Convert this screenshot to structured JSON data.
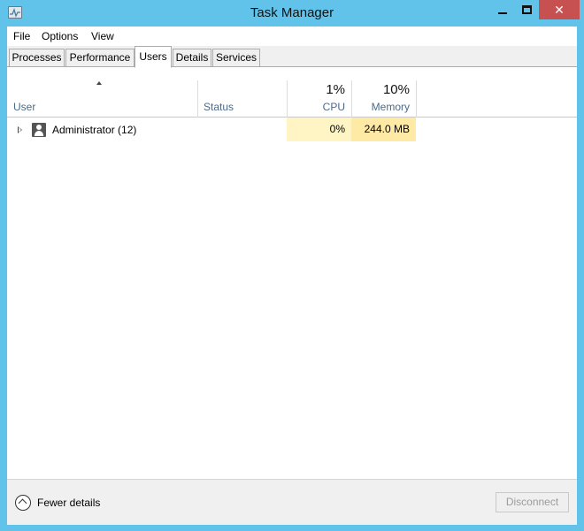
{
  "window": {
    "title": "Task Manager",
    "app_icon": "task-manager-icon",
    "controls": [
      "minimize-icon",
      "maximize-icon",
      "close-icon"
    ],
    "close_label": "✕"
  },
  "menu": {
    "file": "File",
    "options": "Options",
    "view": "View"
  },
  "tabs": [
    {
      "label": "Processes",
      "active": false
    },
    {
      "label": "Performance",
      "active": false
    },
    {
      "label": "Users",
      "active": true
    },
    {
      "label": "Details",
      "active": false
    },
    {
      "label": "Services",
      "active": false
    }
  ],
  "columns": {
    "user": "User",
    "status": "Status",
    "cpu_pct": "1%",
    "cpu": "CPU",
    "memory_pct": "10%",
    "memory": "Memory"
  },
  "rows": [
    {
      "user": "Administrator (12)",
      "status": "",
      "cpu": "0%",
      "memory": "244.0 MB"
    }
  ],
  "footer": {
    "fewer_details": "Fewer details",
    "disconnect": "Disconnect"
  },
  "colors": {
    "frame": "#61c3ea",
    "close": "#c75050",
    "cpu_heat": "#fff4c4",
    "memory_heat": "#ffeaa5"
  }
}
